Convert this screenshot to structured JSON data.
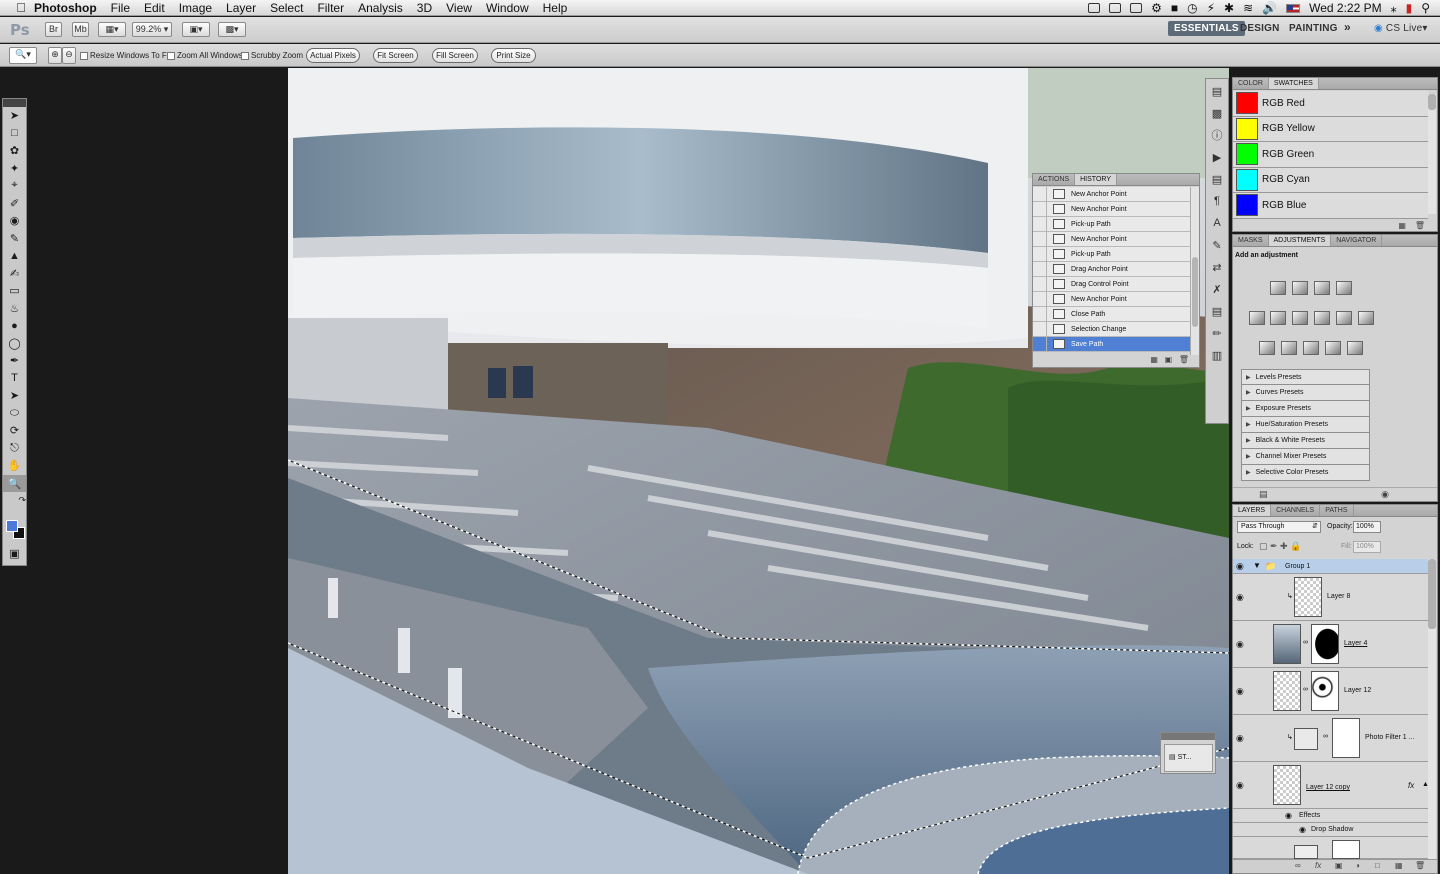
{
  "menubar": {
    "app_name": "Photoshop",
    "menus": [
      "File",
      "Edit",
      "Image",
      "Layer",
      "Select",
      "Filter",
      "Analysis",
      "3D",
      "View",
      "Window",
      "Help"
    ],
    "clock": "Wed 2:22 PM"
  },
  "appbar": {
    "logo": "Ps",
    "bridge": "Br",
    "minibridge": "Mb",
    "zoom": "99.2%",
    "workspaces": [
      "ESSENTIALS",
      "DESIGN",
      "PAINTING"
    ],
    "more": "»",
    "cslive": "CS Live"
  },
  "options": {
    "resize_windows": "Resize Windows To Fit",
    "zoom_all": "Zoom All Windows",
    "scrubby": "Scrubby Zoom",
    "actual_pixels": "Actual Pixels",
    "fit_screen": "Fit Screen",
    "fill_screen": "Fill Screen",
    "print_size": "Print Size"
  },
  "swatches_panel": {
    "tabs": [
      "COLOR",
      "SWATCHES"
    ],
    "active_tab": "SWATCHES",
    "items": [
      {
        "name": "RGB Red",
        "color": "#ff0000"
      },
      {
        "name": "RGB Yellow",
        "color": "#ffff00"
      },
      {
        "name": "RGB Green",
        "color": "#00ff00"
      },
      {
        "name": "RGB Cyan",
        "color": "#00ffff"
      },
      {
        "name": "RGB Blue",
        "color": "#0000ff"
      }
    ]
  },
  "history_panel": {
    "tabs": [
      "ACTIONS",
      "HISTORY"
    ],
    "active_tab": "HISTORY",
    "items": [
      "New Anchor Point",
      "New Anchor Point",
      "Pick-up Path",
      "New Anchor Point",
      "Pick-up Path",
      "Drag Anchor Point",
      "Drag Control Point",
      "New Anchor Point",
      "Close Path",
      "Selection Change",
      "Save Path"
    ],
    "selected": "Save Path"
  },
  "adjustments_panel": {
    "tabs": [
      "MASKS",
      "ADJUSTMENTS",
      "NAVIGATOR"
    ],
    "active_tab": "ADJUSTMENTS",
    "heading": "Add an adjustment",
    "presets": [
      "Levels Presets",
      "Curves Presets",
      "Exposure Presets",
      "Hue/Saturation Presets",
      "Black & White Presets",
      "Channel Mixer Presets",
      "Selective Color Presets"
    ]
  },
  "layers_panel": {
    "tabs": [
      "LAYERS",
      "CHANNELS",
      "PATHS"
    ],
    "active_tab": "LAYERS",
    "blend_mode": "Pass Through",
    "opacity_label": "Opacity:",
    "opacity": "100%",
    "lock_label": "Lock:",
    "fill_label": "Fill:",
    "fill": "100%",
    "group": "Group 1",
    "layers": [
      "Layer 8",
      "Layer 4",
      "Layer 12",
      "Photo Filter 1 ...",
      "Layer 12 copy"
    ],
    "effects_label": "Effects",
    "drop_shadow": "Drop Shadow"
  },
  "mini_panel": {
    "label": "ST..."
  },
  "colors": {
    "foreground": "#4f79d9",
    "background": "#111111",
    "accent": "#4f80d3"
  }
}
